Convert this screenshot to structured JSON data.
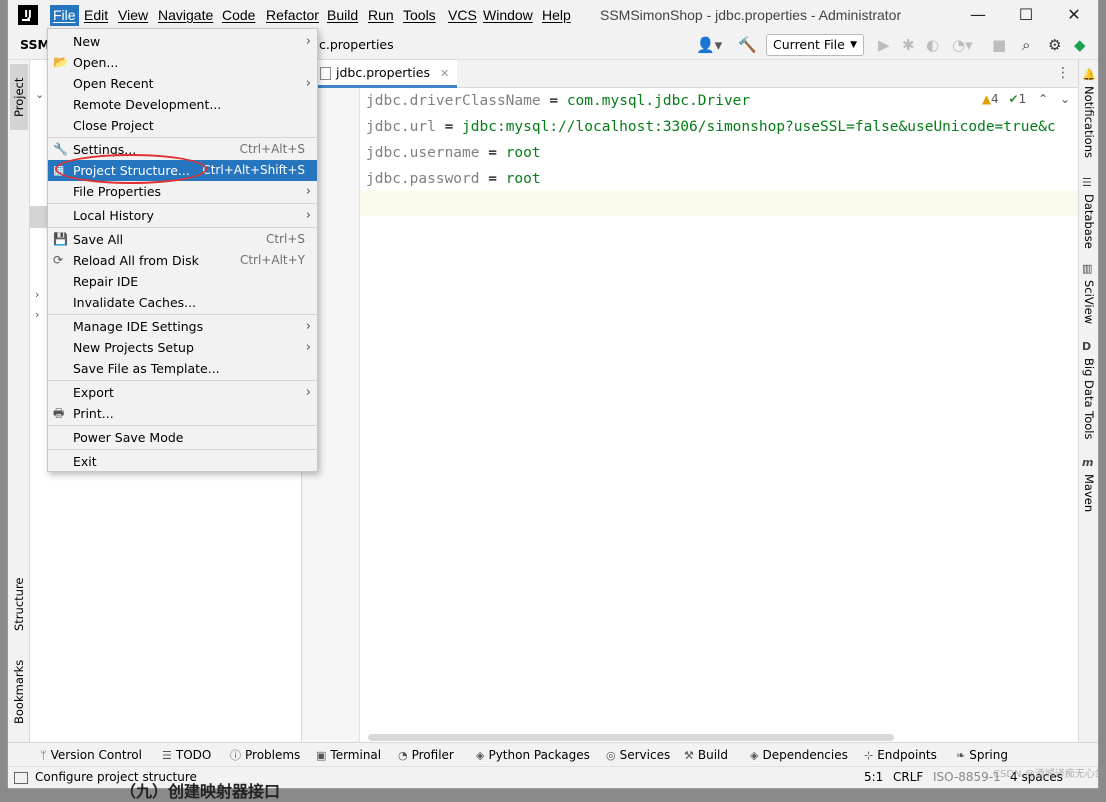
{
  "window": {
    "title": "SSMSimonShop - jdbc.properties - Administrator",
    "logo_text": "IJ",
    "minimize": "—",
    "maximize": "☐",
    "close": "✕"
  },
  "main_menu": [
    "File",
    "Edit",
    "View",
    "Navigate",
    "Code",
    "Refactor",
    "Build",
    "Run",
    "Tools",
    "VCS",
    "Window",
    "Help"
  ],
  "toolbar": {
    "project_crumb": "SSM",
    "file_crumb": "c.properties",
    "run_config": "Current File"
  },
  "left_tool_tabs": {
    "project": "Project",
    "structure": "Structure",
    "bookmarks": "Bookmarks"
  },
  "editor": {
    "tab_label": "jdbc.properties",
    "inspections": {
      "warnings": "4",
      "ok": "1"
    },
    "lines": [
      {
        "key": "jdbc.driverClassName",
        "eq": " = ",
        "value": "com.mysql.jdbc.Driver"
      },
      {
        "key": "jdbc.url",
        "eq": " = ",
        "value": "jdbc:mysql://localhost:3306/simonshop?useSSL=false&useUnicode=true&c"
      },
      {
        "key": "jdbc.username",
        "eq": " = ",
        "value": "root"
      },
      {
        "key": "jdbc.password",
        "eq": " = ",
        "value": "root"
      }
    ]
  },
  "right_tool_tabs": [
    "Notifications",
    "Database",
    "SciView",
    "Big Data Tools",
    "Maven"
  ],
  "file_menu": {
    "items": [
      {
        "label": "New",
        "submenu": true
      },
      {
        "label": "Open...",
        "icon": "folder"
      },
      {
        "label": "Open Recent",
        "submenu": true
      },
      {
        "label": "Remote Development..."
      },
      {
        "label": "Close Project"
      },
      {
        "label": "Settings...",
        "shortcut": "Ctrl+Alt+S",
        "icon": "wrench"
      },
      {
        "label": "Project Structure...",
        "shortcut": "Ctrl+Alt+Shift+S",
        "icon": "project-structure",
        "highlighted": true
      },
      {
        "label": "File Properties",
        "submenu": true
      },
      {
        "label": "Local History",
        "submenu": true
      },
      {
        "label": "Save All",
        "shortcut": "Ctrl+S",
        "icon": "save"
      },
      {
        "label": "Reload All from Disk",
        "shortcut": "Ctrl+Alt+Y",
        "icon": "reload"
      },
      {
        "label": "Repair IDE"
      },
      {
        "label": "Invalidate Caches..."
      },
      {
        "label": "Manage IDE Settings",
        "submenu": true
      },
      {
        "label": "New Projects Setup",
        "submenu": true
      },
      {
        "label": "Save File as Template..."
      },
      {
        "label": "Export",
        "submenu": true
      },
      {
        "label": "Print...",
        "icon": "printer"
      },
      {
        "label": "Power Save Mode"
      },
      {
        "label": "Exit"
      }
    ]
  },
  "bottom_tools": [
    "Version Control",
    "TODO",
    "Problems",
    "Terminal",
    "Profiler",
    "Python Packages",
    "Services",
    "Build",
    "Dependencies",
    "Endpoints",
    "Spring"
  ],
  "status_bar": {
    "message": "Configure project structure",
    "position": "5:1",
    "line_sep": "CRLF",
    "encoding": "ISO-8859-1",
    "indent": "4 spaces",
    "watermark": "CSDN @酒城译痴无心剑"
  },
  "background_text": "（九）创建映射器接口",
  "colors": {
    "accent": "#2675bf",
    "value_green": "#067d17",
    "key_gray": "#808080",
    "highlight_ring": "#e03030"
  }
}
